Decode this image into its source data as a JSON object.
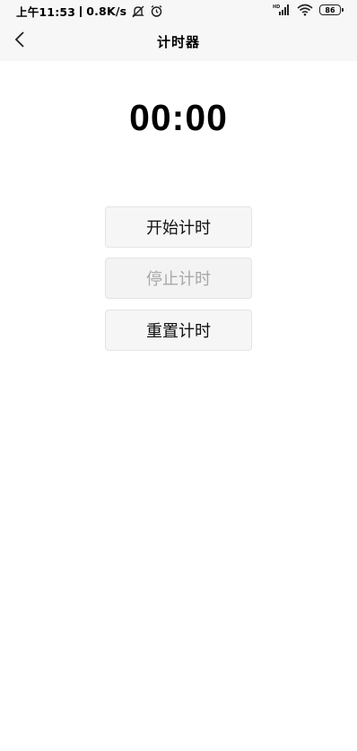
{
  "status_bar": {
    "time": "上午11:53",
    "net_speed": "0.8K/s",
    "signal_label": "HD",
    "battery_level": "86"
  },
  "header": {
    "title": "计时器",
    "back_icon": "chevron-left-icon"
  },
  "timer": {
    "display": "00:00"
  },
  "buttons": {
    "start_label": "开始计时",
    "stop_label": "停止计时",
    "reset_label": "重置计时"
  },
  "colors": {
    "header_bg": "#f7f7f7",
    "button_bg": "#f6f6f6",
    "button_border": "#e4e4e4",
    "disabled_text": "#a8a8a8"
  }
}
